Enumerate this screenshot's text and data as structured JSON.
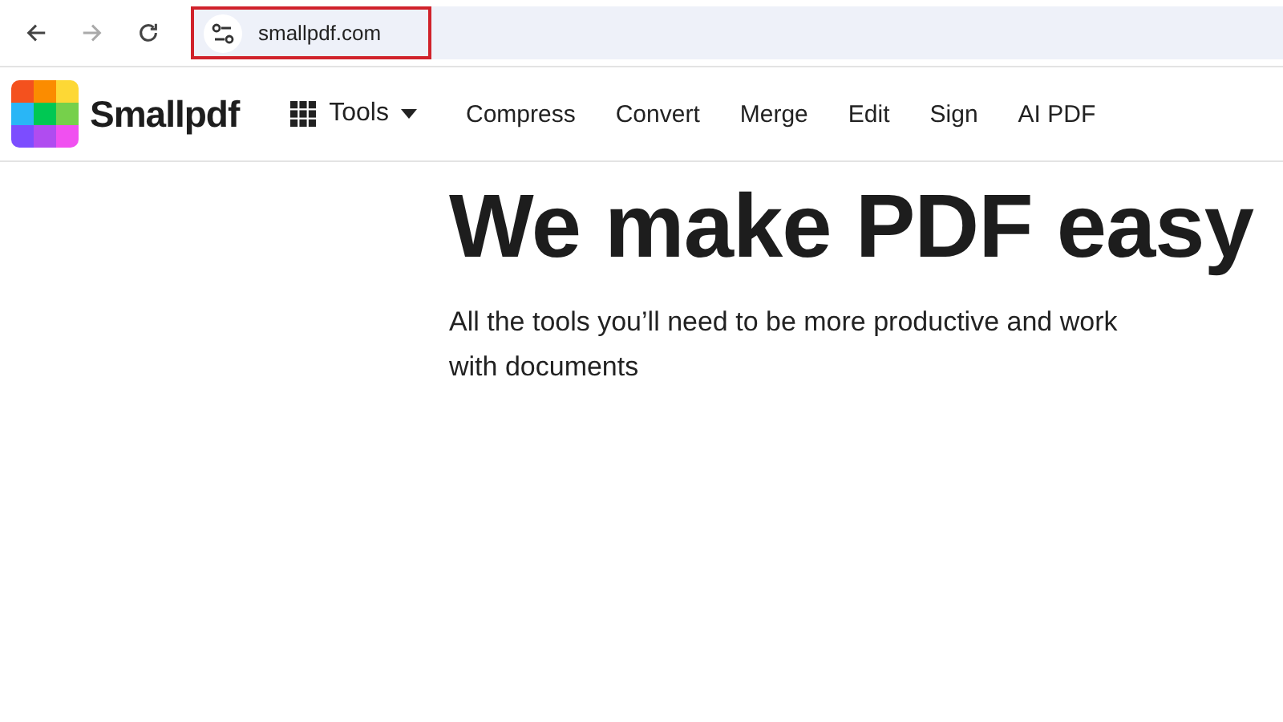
{
  "browser": {
    "back_enabled": true,
    "forward_enabled": false,
    "address": "smallpdf.com",
    "address_highlighted": true
  },
  "nav": {
    "brand": "Smallpdf",
    "tools_label": "Tools",
    "links": [
      "Compress",
      "Convert",
      "Merge",
      "Edit",
      "Sign",
      "AI PDF"
    ]
  },
  "hero": {
    "title": "We make PDF easy",
    "subtitle_lines": [
      "All the tools you’ll need to be more productive and work",
      "with documents"
    ]
  }
}
